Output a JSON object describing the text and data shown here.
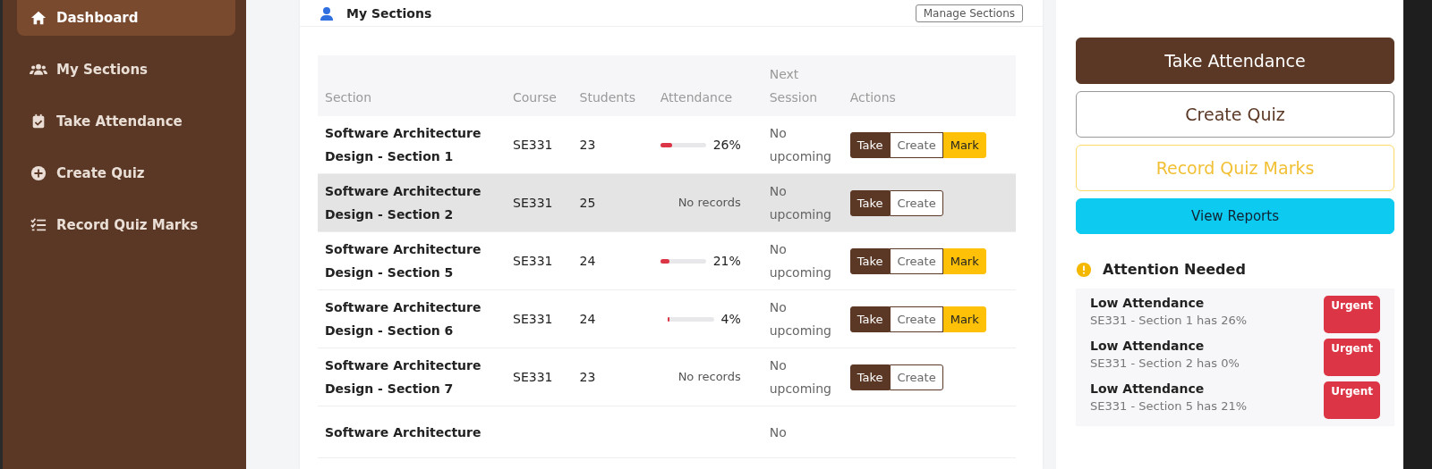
{
  "sidebar": {
    "items": [
      {
        "label": "Dashboard",
        "kind": "home",
        "selected": true
      },
      {
        "label": "My Sections",
        "kind": "users",
        "selected": false
      },
      {
        "label": "Take Attendance",
        "kind": "calendar",
        "selected": false
      },
      {
        "label": "Create Quiz",
        "kind": "plus",
        "selected": false
      },
      {
        "label": "Record Quiz Marks",
        "kind": "list",
        "selected": false
      }
    ]
  },
  "sections_card": {
    "title": "My Sections",
    "manage_button": "Manage Sections",
    "table": {
      "columns": [
        "Section",
        "Course",
        "Students",
        "Attendance",
        "Next Session",
        "Actions"
      ],
      "rows": [
        {
          "section": "Software Architecture Design - Section 1",
          "course": "SE331",
          "students": "23",
          "attendance": {
            "kind": "bar",
            "level": 0.26,
            "reading": "26%"
          },
          "next_session": "No upcoming",
          "selected": false,
          "actions": [
            {
              "kind": "take",
              "label": "Take"
            },
            {
              "kind": "create",
              "label": "Create"
            },
            {
              "kind": "mark",
              "label": "Mark"
            }
          ]
        },
        {
          "section": "Software Architecture Design - Section 2",
          "course": "SE331",
          "students": "25",
          "attendance": {
            "kind": "text",
            "reading": "No records"
          },
          "next_session": "No upcoming",
          "selected": true,
          "actions": [
            {
              "kind": "take",
              "label": "Take"
            },
            {
              "kind": "create",
              "label": "Create"
            }
          ]
        },
        {
          "section": "Software Architecture Design - Section 5",
          "course": "SE331",
          "students": "24",
          "attendance": {
            "kind": "bar",
            "level": 0.21,
            "reading": "21%"
          },
          "next_session": "No upcoming",
          "selected": false,
          "actions": [
            {
              "kind": "take",
              "label": "Take"
            },
            {
              "kind": "create",
              "label": "Create"
            },
            {
              "kind": "mark",
              "label": "Mark"
            }
          ]
        },
        {
          "section": "Software Architecture Design - Section 6",
          "course": "SE331",
          "students": "24",
          "attendance": {
            "kind": "bar",
            "level": 0.04,
            "reading": "4%"
          },
          "next_session": "No upcoming",
          "selected": false,
          "actions": [
            {
              "kind": "take",
              "label": "Take"
            },
            {
              "kind": "create",
              "label": "Create"
            },
            {
              "kind": "mark",
              "label": "Mark"
            }
          ]
        },
        {
          "section": "Software Architecture Design - Section 7",
          "course": "SE331",
          "students": "23",
          "attendance": {
            "kind": "text",
            "reading": "No records"
          },
          "next_session": "No upcoming",
          "selected": false,
          "actions": [
            {
              "kind": "take",
              "label": "Take"
            },
            {
              "kind": "create",
              "label": "Create"
            }
          ]
        },
        {
          "section": "Software Architecture",
          "next_session": "No",
          "selected": false,
          "actions": []
        }
      ]
    }
  },
  "quick_actions": [
    {
      "kind": "primary",
      "label": "Take Attendance"
    },
    {
      "kind": "outline",
      "label": "Create Quiz"
    },
    {
      "kind": "warning",
      "label": "Record Quiz Marks"
    },
    {
      "kind": "info",
      "label": "View Reports"
    }
  ],
  "attention": {
    "title": "Attention Needed",
    "items": [
      {
        "title": "Low Attendance",
        "detail": "SE331 - Section 1 has 26%",
        "badge": "Urgent"
      },
      {
        "title": "Low Attendance",
        "detail": "SE331 - Section 2 has 0%",
        "badge": "Urgent"
      },
      {
        "title": "Low Attendance",
        "detail": "SE331 - Section 5 has 21%",
        "badge": "Urgent"
      }
    ]
  }
}
